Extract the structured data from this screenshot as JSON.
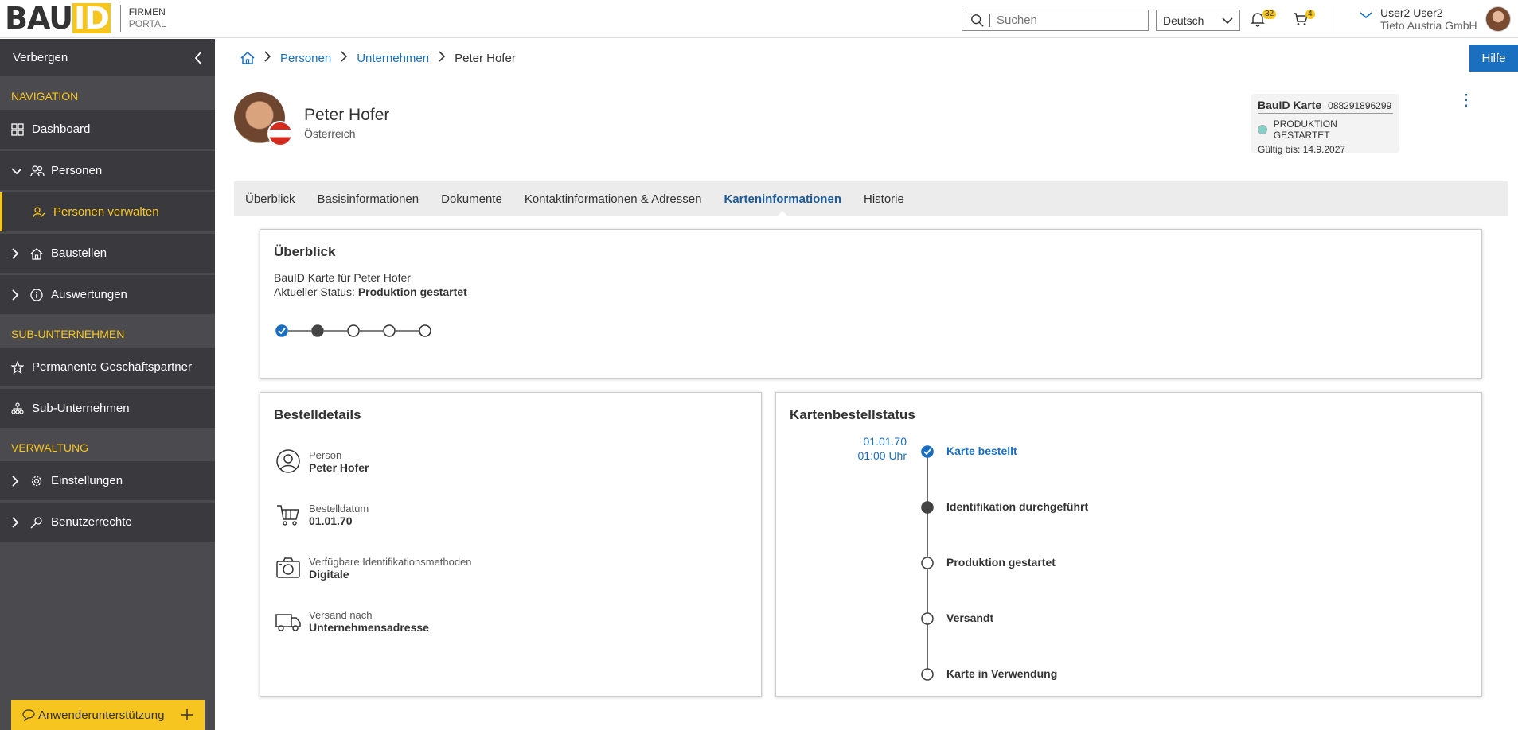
{
  "header": {
    "logo_main": "BAU",
    "logo_accent": "ID",
    "logo_line1": "FIRMEN",
    "logo_line2": "PORTAL",
    "search_placeholder": "Suchen",
    "language": "Deutsch",
    "notifications_count": "32",
    "cart_count": "4",
    "user_name": "User2 User2",
    "user_company": "Tieto Austria GmbH"
  },
  "sidebar": {
    "hide_label": "Verbergen",
    "sections": {
      "navigation": "NAVIGATION",
      "sub": "SUB-UNTERNEHMEN",
      "admin": "VERWALTUNG"
    },
    "items": {
      "dashboard": "Dashboard",
      "personen": "Personen",
      "personen_verwalten": "Personen verwalten",
      "baustellen": "Baustellen",
      "auswertungen": "Auswertungen",
      "permanente": "Permanente Geschäftspartner",
      "subunternehmen": "Sub-Unternehmen",
      "einstellungen": "Einstellungen",
      "benutzerrechte": "Benutzerrechte"
    },
    "support_label": "Anwenderunterstützung"
  },
  "breadcrumb": {
    "personen": "Personen",
    "unternehmen": "Unternehmen",
    "current": "Peter Hofer"
  },
  "help_label": "Hilfe",
  "profile": {
    "name": "Peter Hofer",
    "country": "Österreich"
  },
  "card": {
    "title": "BauID Karte",
    "number": "088291896299",
    "status": "PRODUKTION GESTARTET",
    "valid_until": "Gültig bis: 14.9.2027",
    "status_color": "#7fd3c8"
  },
  "tabs": [
    "Überblick",
    "Basisinformationen",
    "Dokumente",
    "Kontaktinformationen & Adressen",
    "Karteninformationen",
    "Historie"
  ],
  "overview": {
    "title": "Überblick",
    "card_for": "BauID Karte für Peter Hofer",
    "status_label": "Aktueller Status: ",
    "status_value": "Produktion gestartet",
    "steps_done": 1,
    "steps_current": 2,
    "steps_total": 5
  },
  "order_details": {
    "title": "Bestelldetails",
    "person_label": "Person",
    "person_value": "Peter Hofer",
    "date_label": "Bestelldatum",
    "date_value": "01.01.70",
    "ident_label": "Verfügbare Identifikationsmethoden",
    "ident_value": "Digitale",
    "ship_label": "Versand nach",
    "ship_value": "Unternehmensadresse"
  },
  "order_status": {
    "title": "Kartenbestellstatus",
    "date": "01.01.70",
    "time": "01:00 Uhr",
    "steps": [
      "Karte bestellt",
      "Identifikation durchgeführt",
      "Produktion gestartet",
      "Versandt",
      "Karte in Verwendung"
    ]
  },
  "colors": {
    "accent": "#f7c520",
    "link": "#1a6fc0",
    "sidebar": "#4a4a4f"
  }
}
